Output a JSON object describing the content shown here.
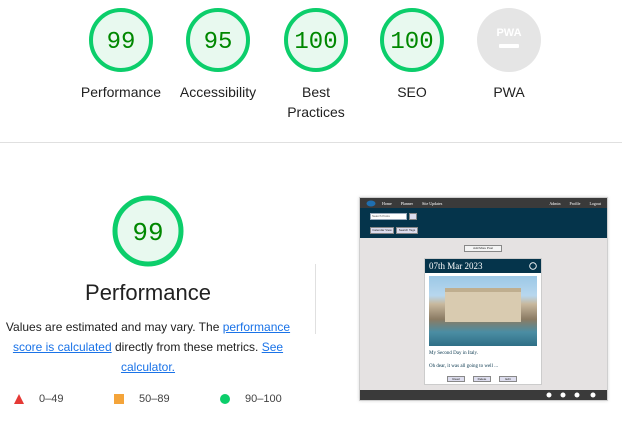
{
  "scores": [
    {
      "key": "performance",
      "value": "99",
      "label": "Performance",
      "type": "pass"
    },
    {
      "key": "accessibility",
      "value": "95",
      "label": "Accessibility",
      "type": "pass"
    },
    {
      "key": "best_practices",
      "value": "100",
      "label": "Best Practices",
      "type": "pass"
    },
    {
      "key": "seo",
      "value": "100",
      "label": "SEO",
      "type": "pass"
    },
    {
      "key": "pwa",
      "value": "PWA",
      "label": "PWA",
      "type": "na"
    }
  ],
  "detail": {
    "score": "99",
    "title": "Performance",
    "desc_prefix": "Values are estimated and may vary. The ",
    "link_perf": "performance score is calculated",
    "desc_mid": " directly from these metrics. ",
    "link_calc": "See calculator."
  },
  "legend": [
    {
      "range": "0–49",
      "color": "#e53935"
    },
    {
      "range": "50–89",
      "color": "#f4a43a"
    },
    {
      "range": "90–100",
      "color": "#0cce6b"
    }
  ],
  "colors": {
    "pass_stroke": "#0cce6b",
    "pass_fill": "#e8f9ef",
    "pass_text": "#008800",
    "na": "#cccccc"
  },
  "preview": {
    "nav_left": [
      "Home",
      "Planner",
      "Site Updates"
    ],
    "nav_right": [
      "Admin",
      "Profile",
      "Logout"
    ],
    "search_placeholder": "Search Posts",
    "btn_calendar": "Calendar View",
    "btn_search": "Search Tags",
    "add_post": "Add More Post",
    "card_title": "07th Mar 2023",
    "card_line1": "My Second Day in Italy.",
    "card_line2": "Oh dear, it was all going to well ...",
    "card_btns": [
      "Read",
      "Delete",
      "Edit"
    ]
  }
}
